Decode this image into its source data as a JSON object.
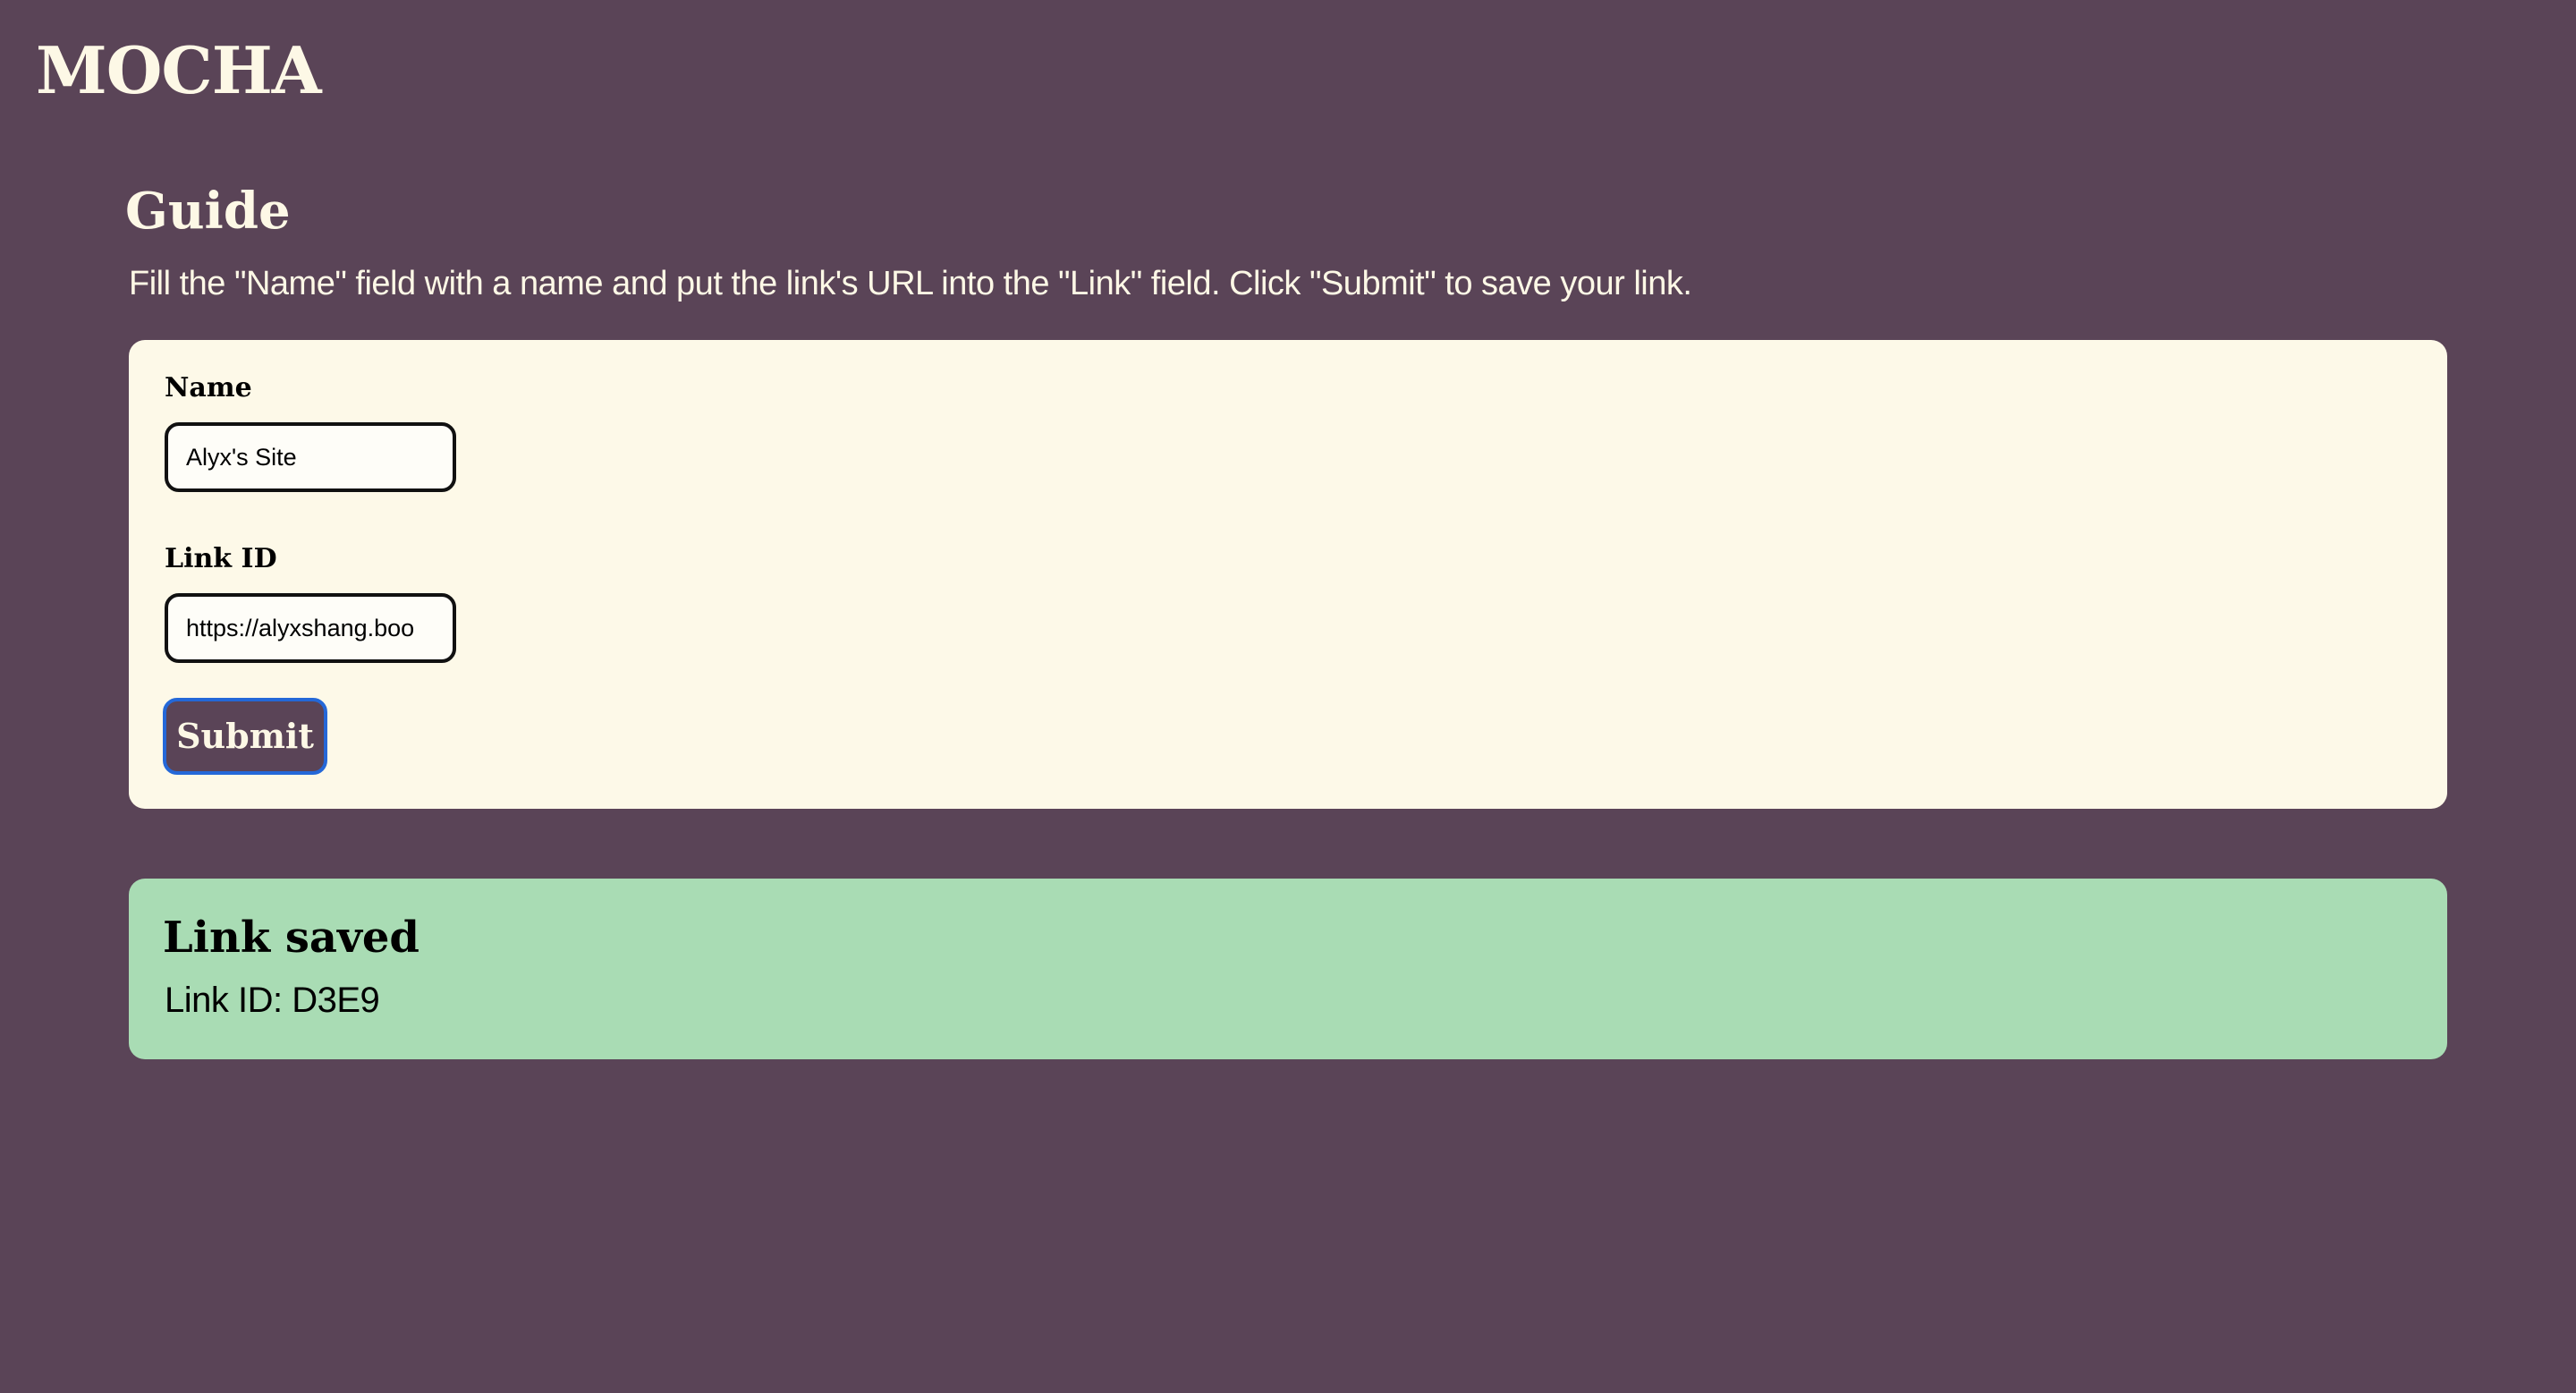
{
  "header": {
    "logo": "MOCHA"
  },
  "guide": {
    "title": "Guide",
    "text": "Fill the \"Name\" field with a name and put the link's URL into the \"Link\" field. Click \"Submit\" to save your link."
  },
  "form": {
    "name_label": "Name",
    "name_value": "Alyx's Site",
    "link_label": "Link ID",
    "link_value": "https://alyxshang.boo",
    "submit_label": "Submit"
  },
  "result": {
    "title": "Link saved",
    "text": "Link ID: D3E9"
  },
  "colors": {
    "background": "#5a4457",
    "card": "#fdf9e8",
    "success": "#a9dcb4",
    "focus_ring": "#2468d8",
    "text_light": "#fdf8e6"
  }
}
